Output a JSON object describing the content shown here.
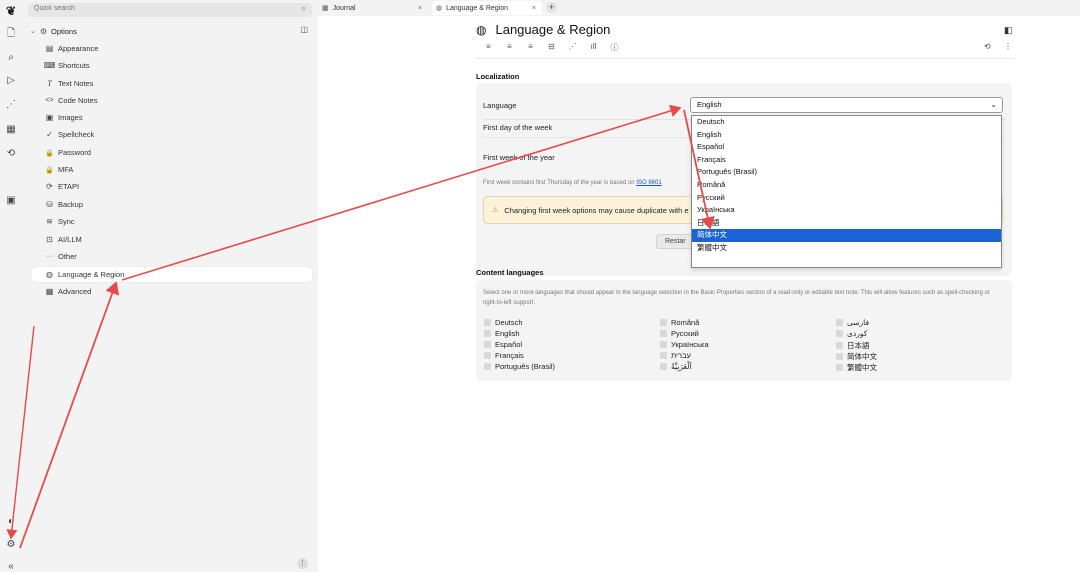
{
  "rail": {
    "icons": [
      "app-logo-icon",
      "new-note-icon",
      "search-icon",
      "send-icon",
      "share-graph-icon",
      "calendar-icon",
      "history-icon",
      "today-icon",
      "protected-icon",
      "settings-icon",
      "collapse-icon"
    ]
  },
  "sidebar": {
    "search_placeholder": "Quick search",
    "search_icon": "⌕",
    "root_label": "Options",
    "items": [
      {
        "label": "Appearance",
        "icon": "▤"
      },
      {
        "label": "Shortcuts",
        "icon": "⌨"
      },
      {
        "label": "Text Notes",
        "icon": "T"
      },
      {
        "label": "Code Notes",
        "icon": "<>"
      },
      {
        "label": "Images",
        "icon": "▣"
      },
      {
        "label": "Spellcheck",
        "icon": "✓"
      },
      {
        "label": "Password",
        "icon": "🔒"
      },
      {
        "label": "MFA",
        "icon": "🔒"
      },
      {
        "label": "ETAPI",
        "icon": "⟳"
      },
      {
        "label": "Backup",
        "icon": "⛁"
      },
      {
        "label": "Sync",
        "icon": "≋"
      },
      {
        "label": "AI/LLM",
        "icon": "⊡"
      },
      {
        "label": "Other",
        "icon": "···"
      },
      {
        "label": "Language & Region",
        "icon": "◍"
      },
      {
        "label": "Advanced",
        "icon": "▦"
      }
    ],
    "footer_left": "«",
    "footer_right": "⋮"
  },
  "tabs": [
    {
      "label": "Journal",
      "icon": "▦",
      "close": "×"
    },
    {
      "label": "Language & Region",
      "icon": "◍",
      "close": "×"
    }
  ],
  "new_tab": "+",
  "note": {
    "title": "Language & Region",
    "title_icon": "◍",
    "panel_toggle": "◧",
    "toolbar_icons": [
      "≡",
      "≡",
      "≡",
      "⊟",
      "⋰",
      "ıll",
      "ⓘ"
    ],
    "history_icon": "⟲",
    "more_icon": "⋮"
  },
  "localization": {
    "heading": "Localization",
    "language_label": "Language",
    "language_value": "English",
    "first_day_label": "First day of the week",
    "first_week_label": "First week of the year",
    "first_week_note": "First week contains first Thursday of the year is based on",
    "first_week_link": "ISO 8601",
    "warning_icon": "⚠",
    "warning_text": "Changing first week options may cause duplicate with e",
    "restore_label": "Restar",
    "dropdown_options": [
      "Deutsch",
      "English",
      "Español",
      "Français",
      "Português (Brasil)",
      "Română",
      "Русский",
      "Українська",
      "日本語",
      "简体中文",
      "繁體中文"
    ],
    "dropdown_selected_index": 9
  },
  "content_languages": {
    "heading": "Content languages",
    "description": "Select one or more languages that should appear in the language selection in the Basic Properties section of a read-only or editable text note. This will allow features such as spell-checking or right-to-left support.",
    "columns": [
      [
        "Deutsch",
        "English",
        "Español",
        "Français",
        "Português (Brasil)"
      ],
      [
        "Română",
        "Русский",
        "Українська",
        "עברית",
        "اَلْعَرَبِيَّةُ"
      ],
      [
        "فارسی",
        "کوردی",
        "日本語",
        "简体中文",
        "繁體中文"
      ]
    ]
  },
  "colors": {
    "selected_option": "#1a63d6",
    "annotation_arrow": "#e84a4a",
    "link": "#1a56b8"
  }
}
